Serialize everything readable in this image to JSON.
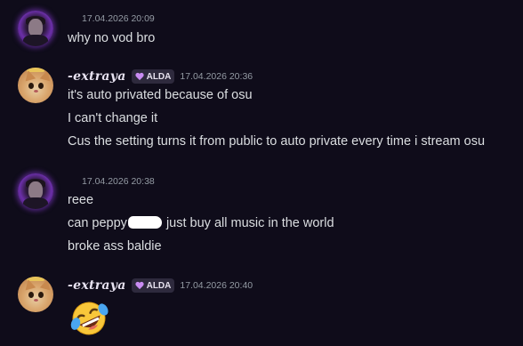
{
  "messages": [
    {
      "avatar": "purple-avatar",
      "timestamp": "17.04.2026 20:09",
      "lines": [
        "why no vod bro"
      ]
    },
    {
      "avatar": "cat-avatar",
      "username": "-𝒆𝒙𝒕𝒓𝒂𝒚𝒂",
      "tag": "ALDA",
      "tag_icon": "heart-icon",
      "tag_color": "#c98cf2",
      "timestamp": "17.04.2026 20:36",
      "lines": [
        "it's auto privated because of osu",
        "I can't change it",
        "Cus the setting turns it from public to auto private every time i stream osu"
      ]
    },
    {
      "avatar": "purple-avatar",
      "timestamp": "17.04.2026 20:38",
      "lines": [
        "reee"
      ],
      "line2_pre": "can peppy",
      "line2_post": " just buy all music in the world",
      "line3": "broke ass baldie"
    },
    {
      "avatar": "cat-avatar",
      "username": "-𝒆𝒙𝒕𝒓𝒂𝒚𝒂",
      "tag": "ALDA",
      "tag_icon": "heart-icon",
      "timestamp": "17.04.2026 20:40",
      "emoji": "rolling-on-floor-laughing-emoji"
    }
  ],
  "colors": {
    "background": "#0f0c1a",
    "text": "#dbdee1",
    "timestamp": "#949ba4",
    "tag_bg": "#2e2a3d"
  }
}
